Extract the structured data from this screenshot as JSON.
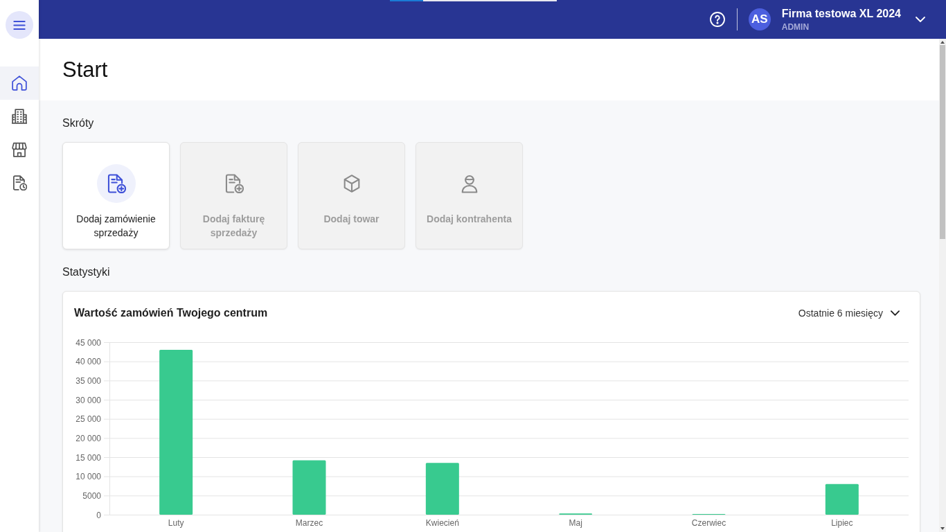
{
  "loading_bar": {
    "level": 0.2
  },
  "sidebar": {
    "items": [
      {
        "selected": true
      },
      {
        "selected": false
      },
      {
        "selected": false
      },
      {
        "selected": false
      }
    ]
  },
  "header": {
    "user": {
      "initials": "AS",
      "company": "Firma testowa XL 2024",
      "role": "ADMIN"
    }
  },
  "page": {
    "title": "Start"
  },
  "shortcuts": {
    "heading": "Skróty",
    "items": [
      {
        "label": "Dodaj zamówienie sprzedaży",
        "disabled": false
      },
      {
        "label": "Dodaj fakturę sprzedaży",
        "disabled": true
      },
      {
        "label": "Dodaj towar",
        "disabled": true
      },
      {
        "label": "Dodaj kontrahenta",
        "disabled": true
      }
    ]
  },
  "statistics": {
    "heading": "Statystyki",
    "chart_card": {
      "period": "Ostatnie 6 miesięcy",
      "chart_data": {
        "type": "bar",
        "title": "Wartość zamówień Twojego centrum",
        "categories": [
          "Luty",
          "Marzec",
          "Kwiecień",
          "Maj",
          "Czerwiec",
          "Lipiec"
        ],
        "series": [
          {
            "color": "#38ca8f",
            "values": [
              43000,
              14200,
              13500,
              300,
              100,
              8000
            ]
          }
        ],
        "ylim": [
          0,
          45000
        ],
        "yticks": [
          0,
          5000,
          {
            "value": 10000,
            "label": "10 000"
          },
          {
            "value": 15000,
            "label": "15 000"
          },
          {
            "value": 20000,
            "label": "20 000"
          },
          {
            "value": 25000,
            "label": "25 000"
          },
          {
            "value": 30000,
            "label": "30 000"
          },
          {
            "value": 35000,
            "label": "35 000"
          },
          {
            "value": 40000,
            "label": "40 000"
          },
          {
            "value": 45000,
            "label": "45 000"
          }
        ],
        "grid": true
      }
    }
  }
}
